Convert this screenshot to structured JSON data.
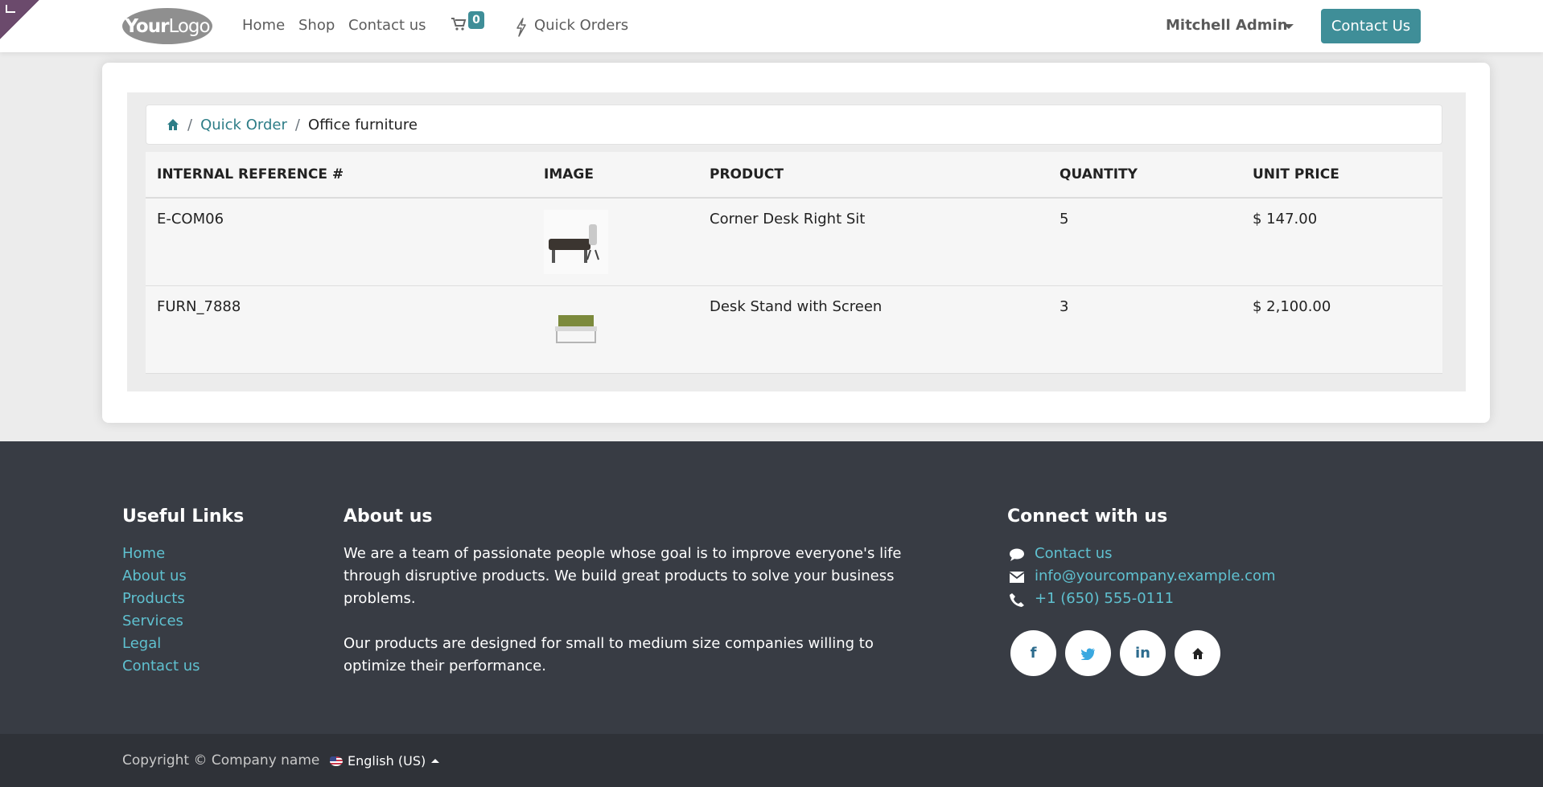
{
  "header": {
    "logo_bold": "Your",
    "logo_light": "Logo",
    "nav": [
      {
        "label": "Home"
      },
      {
        "label": "Shop"
      },
      {
        "label": "Contact us"
      }
    ],
    "cart_count": "0",
    "quick_orders": "Quick Orders",
    "user": "Mitchell Admin",
    "contact_button": "Contact Us"
  },
  "breadcrumb": {
    "link": "Quick Order",
    "current": "Office furniture"
  },
  "table": {
    "headers": [
      "INTERNAL REFERENCE #",
      "IMAGE",
      "PRODUCT",
      "QUANTITY",
      "UNIT PRICE"
    ],
    "rows": [
      {
        "ref": "E-COM06",
        "product": "Corner Desk Right Sit",
        "quantity": "5",
        "price": "$ 147.00"
      },
      {
        "ref": "FURN_7888",
        "product": "Desk Stand with Screen",
        "quantity": "3",
        "price": "$ 2,100.00"
      }
    ]
  },
  "footer": {
    "useful_links_title": "Useful Links",
    "useful_links": [
      "Home",
      "About us",
      "Products",
      "Services",
      "Legal",
      "Contact us"
    ],
    "about_title": "About us",
    "about_lines": [
      "We are a team of passionate people whose goal is to improve everyone's life",
      "through disruptive products. We build great products to solve your business",
      "problems."
    ],
    "about_lines_2": [
      "Our products are designed for small to medium size companies willing to",
      "optimize their performance."
    ],
    "connect_title": "Connect with us",
    "contact_link": "Contact us",
    "email": "info@yourcompany.example.com",
    "phone": "+1 (650) 555-0111",
    "social": {
      "facebook": "f",
      "linkedin": "in"
    },
    "copyright": "Copyright © Company name",
    "language": "English (US)"
  },
  "colors": {
    "accent": "#3f8e98",
    "footer_bg": "#383c44",
    "footer_link": "#5fc1d0"
  }
}
